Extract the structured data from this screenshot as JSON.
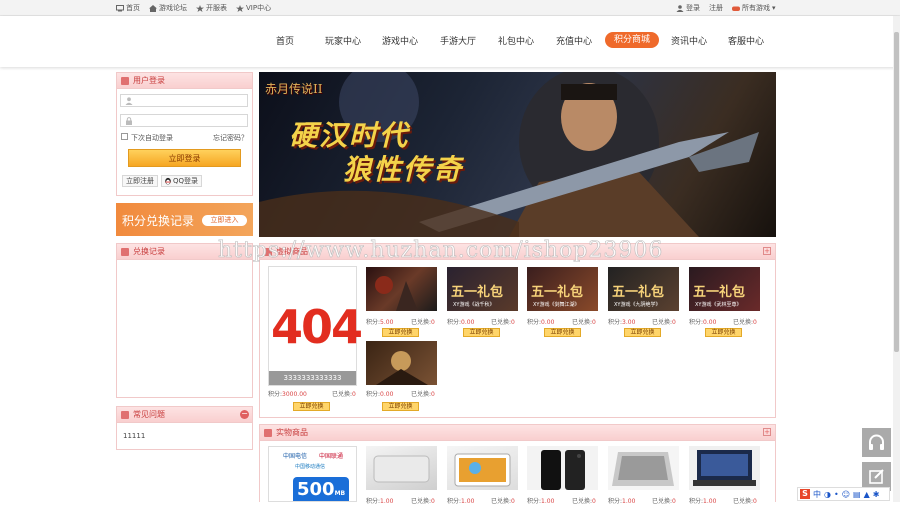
{
  "topbar": {
    "links": [
      {
        "label": "首页",
        "icon": "computer-icon"
      },
      {
        "label": "游戏论坛",
        "icon": "home-icon"
      },
      {
        "label": "开服表",
        "icon": "star-icon"
      },
      {
        "label": "VIP中心",
        "icon": "star-icon"
      }
    ],
    "login": "登录",
    "register": "注册",
    "all_games": "所有游戏"
  },
  "nav": {
    "items": [
      "首页",
      "玩家中心",
      "游戏中心",
      "手游大厅",
      "礼包中心",
      "充值中心",
      "积分商城",
      "资讯中心",
      "客服中心"
    ],
    "active_index": 6,
    "accent": "#ef6a2b"
  },
  "login_panel": {
    "title": "用户登录",
    "username_placeholder": "",
    "password_placeholder": "",
    "remember": "下次自动登录",
    "forgot": "忘记密码？",
    "submit": "立即登录",
    "register": "立即注册",
    "qq_login": "QQ登录"
  },
  "promo": {
    "title": "积分兑换记录",
    "button": "立即进入"
  },
  "exchange_panel": {
    "title": "兑换记录"
  },
  "faq_panel": {
    "title": "常见问题",
    "items": [
      "11111"
    ]
  },
  "banner": {
    "logo": "赤月传说II",
    "headline_1": "硬汉时代",
    "headline_2": "狼性传奇"
  },
  "virtual_panel": {
    "title": "虚拟商品",
    "featured": {
      "image_text": "404",
      "caption": "3333333333333",
      "price_label": "积分:",
      "price": "3000.00",
      "sold_label": "已兑换:",
      "sold": "0",
      "button": "立即兑换"
    },
    "products": [
      {
        "banner": "",
        "price": "5.00",
        "sold": "0"
      },
      {
        "banner": "五一礼包",
        "sub": "XY游戏《战千秋》",
        "price": "0.00",
        "sold": "0"
      },
      {
        "banner": "五一礼包",
        "sub": "XY游戏《剑舞江湖》",
        "price": "0.00",
        "sold": "0"
      },
      {
        "banner": "五一礼包",
        "sub": "XY游戏《九阴绝学》",
        "price": "3.00",
        "sold": "0"
      },
      {
        "banner": "五一礼包",
        "sub": "XY游戏《武林至尊》",
        "price": "0.00",
        "sold": "0"
      },
      {
        "banner": "",
        "price": "0.00",
        "sold": "0"
      }
    ],
    "price_label": "积分:",
    "sold_label": "已兑换:",
    "button": "立即兑换"
  },
  "physical_panel": {
    "title": "实物商品",
    "featured": {
      "brand_1": "中国电信",
      "brand_2": "中国联通",
      "brand_3": "中国移动通信",
      "data": "500",
      "unit": "MB"
    },
    "products": [
      {
        "price": "1.00",
        "sold": "0"
      },
      {
        "price": "1.00",
        "sold": "0"
      },
      {
        "price": "1.00",
        "sold": "0"
      },
      {
        "price": "1.00",
        "sold": "0"
      },
      {
        "price": "1.00",
        "sold": "0"
      }
    ]
  },
  "watermark": "https://www.huzhan.com/ishop23906",
  "tray": "中"
}
